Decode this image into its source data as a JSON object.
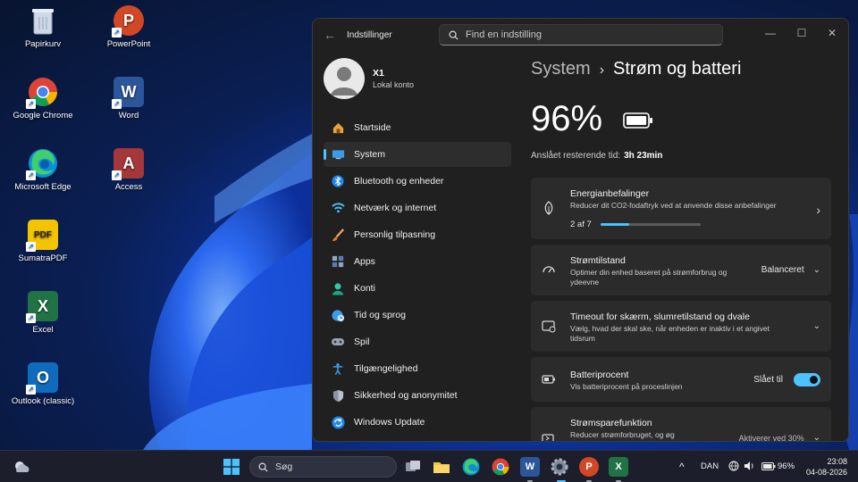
{
  "desktop": {
    "icons": [
      {
        "label": "Papirkurv",
        "icon": "recycle-bin-icon"
      },
      {
        "label": "PowerPoint",
        "icon": "powerpoint-icon",
        "glyph": "P",
        "color": "#d24726"
      },
      {
        "label": "Google Chrome",
        "icon": "chrome-icon"
      },
      {
        "label": "Word",
        "icon": "word-icon",
        "glyph": "W",
        "color": "#2b579a"
      },
      {
        "label": "Microsoft Edge",
        "icon": "edge-icon"
      },
      {
        "label": "Access",
        "icon": "access-icon",
        "glyph": "A",
        "color": "#a4373a"
      },
      {
        "label": "SumatraPDF",
        "icon": "sumatrapdf-icon",
        "glyph": "PDF",
        "color": "#f5c400"
      },
      {
        "label": "Excel",
        "icon": "excel-icon",
        "glyph": "X",
        "color": "#217346"
      },
      {
        "label": "Outlook (classic)",
        "icon": "outlook-icon",
        "glyph": "O",
        "color": "#0f6cbd"
      }
    ]
  },
  "window": {
    "back_glyph": "←",
    "title": "Indstillinger",
    "search_placeholder": "Find en indstilling",
    "controls": {
      "minimize": "—",
      "maximize": "☐",
      "close": "✕"
    }
  },
  "profile": {
    "name": "X1",
    "subtitle": "Lokal konto"
  },
  "nav": {
    "items": [
      {
        "label": "Startside",
        "icon": "home-icon"
      },
      {
        "label": "System",
        "icon": "system-icon",
        "active": true
      },
      {
        "label": "Bluetooth og enheder",
        "icon": "bluetooth-icon"
      },
      {
        "label": "Netværk og internet",
        "icon": "wifi-icon"
      },
      {
        "label": "Personlig tilpasning",
        "icon": "brush-icon"
      },
      {
        "label": "Apps",
        "icon": "apps-icon"
      },
      {
        "label": "Konti",
        "icon": "account-icon"
      },
      {
        "label": "Tid og sprog",
        "icon": "globe-clock-icon"
      },
      {
        "label": "Spil",
        "icon": "gamepad-icon"
      },
      {
        "label": "Tilgængelighed",
        "icon": "accessibility-icon"
      },
      {
        "label": "Sikkerhed og anonymitet",
        "icon": "shield-icon"
      },
      {
        "label": "Windows Update",
        "icon": "update-icon"
      }
    ]
  },
  "content": {
    "breadcrumb_parent": "System",
    "breadcrumb_sep": "›",
    "breadcrumb_current": "Strøm og batteri",
    "battery_percent": "96%",
    "battery_level": 0.96,
    "remaining_label": "Anslået resterende tid:",
    "remaining_value": "3h 23min",
    "cards": {
      "energy": {
        "title": "Energianbefalinger",
        "subtitle": "Reducer dit CO2-fodaftryk ved at anvende disse anbefalinger",
        "progress_label": "2 af 7",
        "progress_fraction": 0.2857,
        "chevron": "›"
      },
      "power_mode": {
        "title": "Strømtilstand",
        "subtitle": "Optimer din enhed baseret på strømforbrug og ydeevne",
        "value": "Balanceret",
        "chevron": "⌄"
      },
      "timeout": {
        "title": "Timeout for skærm, slumretilstand og dvale",
        "subtitle": "Vælg, hvad der skal ske, når enheden er inaktiv i et angivet tidsrum",
        "chevron": "⌄"
      },
      "battery_pct": {
        "title": "Batteriprocent",
        "subtitle": "Vis batteriprocent på proceslinjen",
        "value": "Slået til"
      },
      "saver": {
        "title": "Strømsparefunktion",
        "subtitle": "Reducer strømforbruget, og øg",
        "value": "Aktiverer ved 30%",
        "chevron": "⌄"
      }
    }
  },
  "taskbar": {
    "search_label": "Søg",
    "language": "DAN",
    "battery": "96%",
    "time": "23:08",
    "date": "04-08-2026",
    "tray_chevron": "^"
  }
}
